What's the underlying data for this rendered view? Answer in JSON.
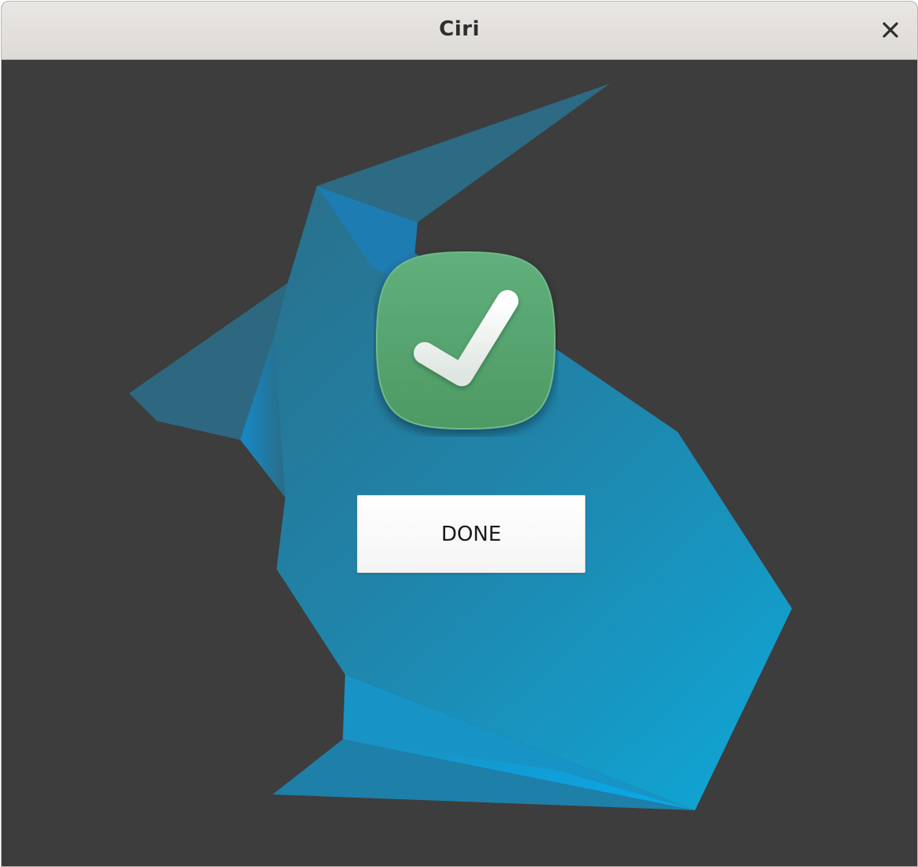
{
  "window": {
    "title": "Ciri",
    "close_icon": "close-icon"
  },
  "main": {
    "background_graphic": "rabbit-logo",
    "status_icon": "checkmark-success-icon",
    "done_label": "DONE"
  },
  "colors": {
    "titlebar": "#e0dcd8",
    "content_background": "#3d3d3d",
    "rabbit_blue": "#1e86b0",
    "success_green": "#55a46e",
    "button_background": "#ffffff"
  }
}
